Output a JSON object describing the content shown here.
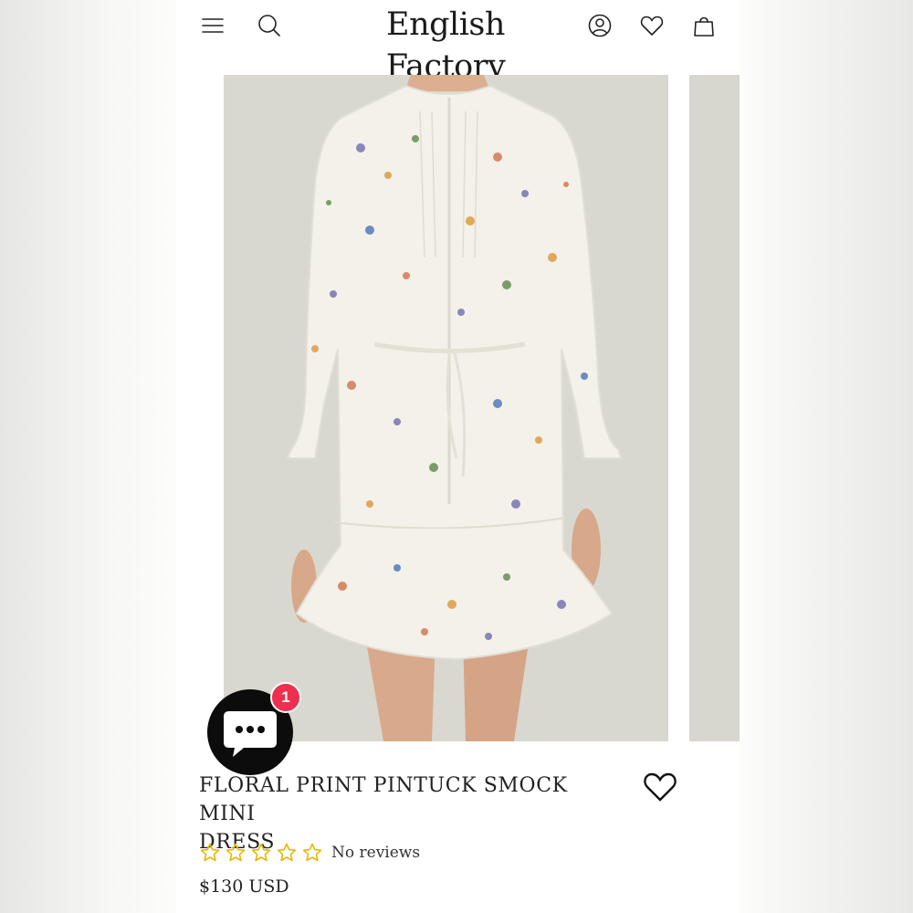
{
  "header": {
    "logo": "English Factory",
    "icons": [
      "menu-icon",
      "search-icon",
      "account-icon",
      "heart-icon",
      "bag-icon"
    ]
  },
  "gallery": {
    "image_subject": "floral print pintuck smock mini dress",
    "visible_slides": 2
  },
  "chat": {
    "icon": "chat-icon",
    "badge": "1"
  },
  "product": {
    "title_line1": "FLORAL PRINT PINTUCK SMOCK MINI",
    "title_line2": "DRESS",
    "rating": 0,
    "rating_max": 5,
    "reviews_text": "No reviews",
    "price": "$130 USD"
  },
  "colors": {
    "star": "#e6b800",
    "badge": "#ee2f4f",
    "chat_bg": "#0c0c0c",
    "image_bg": "#d9d8d0"
  }
}
